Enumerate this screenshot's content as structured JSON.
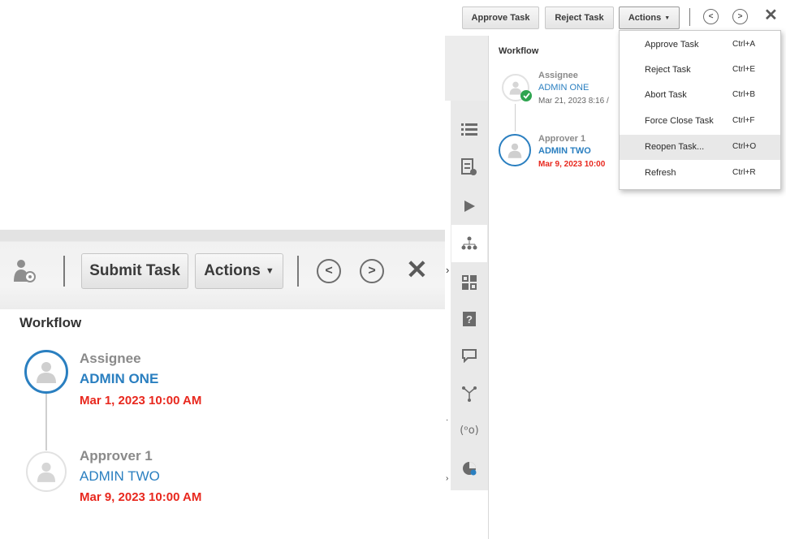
{
  "left_panel": {
    "toolbar": {
      "submit_label": "Submit Task",
      "actions_label": "Actions"
    },
    "workflow_title": "Workflow",
    "workflow": [
      {
        "role": "Assignee",
        "name": "ADMIN ONE",
        "date": "Mar 1, 2023 10:00 AM",
        "status": "current"
      },
      {
        "role": "Approver 1",
        "name": "ADMIN TWO",
        "date": "Mar 9, 2023 10:00 AM",
        "status": "pending"
      }
    ]
  },
  "right_panel": {
    "toolbar": {
      "approve_label": "Approve Task",
      "reject_label": "Reject Task",
      "actions_label": "Actions"
    },
    "workflow_title": "Workflow",
    "workflow": [
      {
        "role": "Assignee",
        "name": "ADMIN ONE",
        "date": "Mar 21, 2023 8:16 /",
        "status": "completed"
      },
      {
        "role": "Approver 1",
        "name": "ADMIN TWO",
        "date": "Mar 9, 2023 10:00",
        "status": "current"
      }
    ],
    "actions_menu": [
      {
        "label": "Approve Task",
        "shortcut": "Ctrl+A"
      },
      {
        "label": "Reject Task",
        "shortcut": "Ctrl+E"
      },
      {
        "label": "Abort Task",
        "shortcut": "Ctrl+B"
      },
      {
        "label": "Force Close Task",
        "shortcut": "Ctrl+F"
      },
      {
        "label": "Reopen Task...",
        "shortcut": "Ctrl+O",
        "highlighted": true
      },
      {
        "label": "Refresh",
        "shortcut": "Ctrl+R"
      }
    ],
    "rail_icons": [
      "list-icon",
      "document-details-icon",
      "play-icon",
      "hierarchy-icon",
      "grid-icon",
      "help-document-icon",
      "comment-icon",
      "branch-icon",
      "broadcast-icon",
      "pie-chart-icon"
    ]
  },
  "colors": {
    "link_blue": "#2a7fc0",
    "date_red": "#e8281e",
    "completed_green": "#2ea44f",
    "active_ring": "#2a7fc0"
  }
}
